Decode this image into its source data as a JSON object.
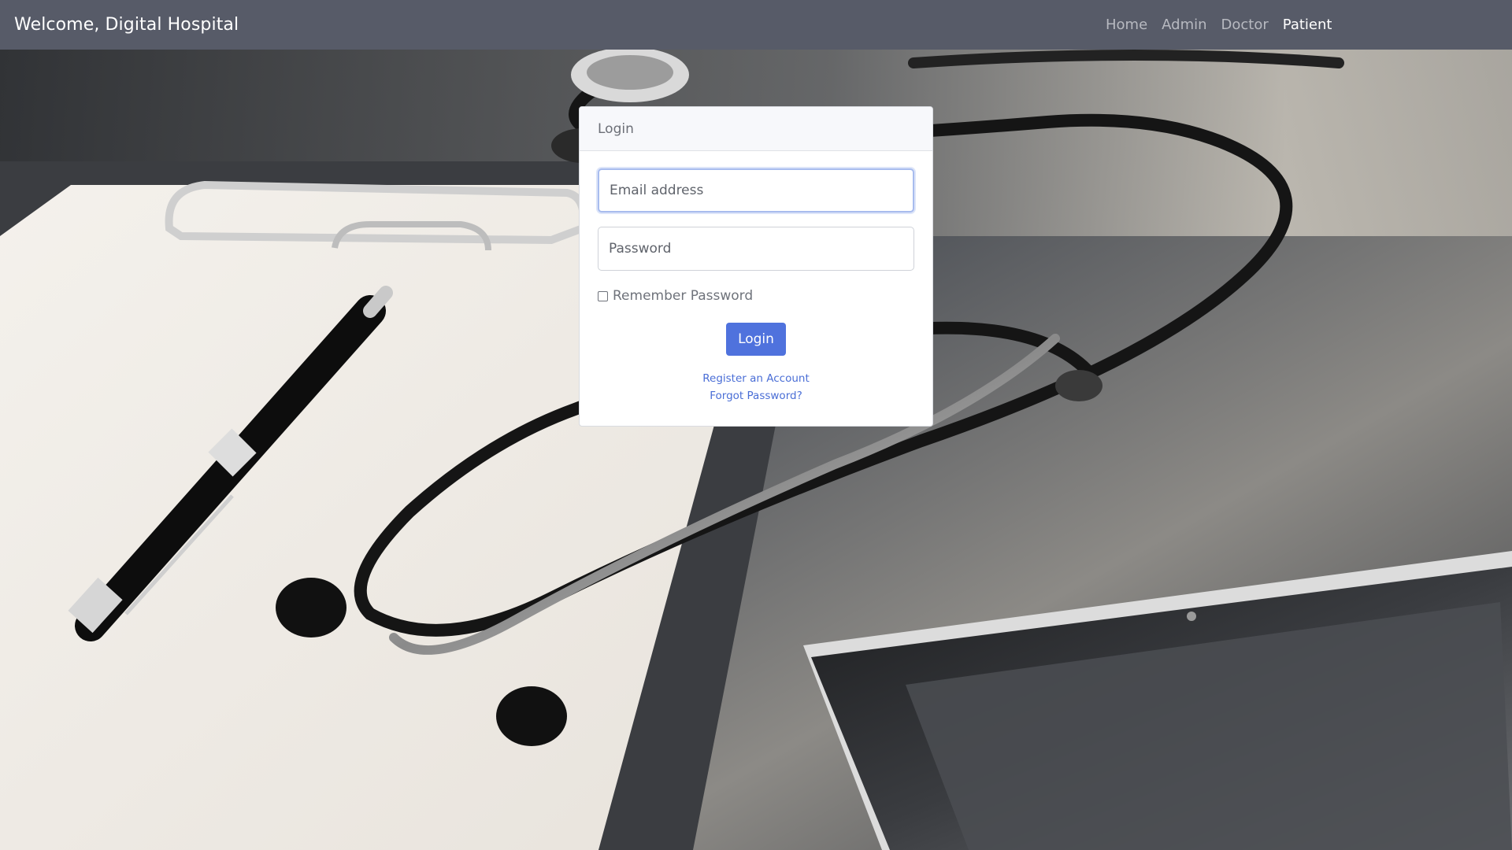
{
  "navbar": {
    "brand": "Welcome, Digital Hospital",
    "links": [
      {
        "label": "Home",
        "active": false
      },
      {
        "label": "Admin",
        "active": false
      },
      {
        "label": "Doctor",
        "active": false
      },
      {
        "label": "Patient",
        "active": true
      }
    ]
  },
  "login": {
    "title": "Login",
    "email_placeholder": "Email address",
    "email_value": "",
    "password_placeholder": "Password",
    "password_value": "",
    "remember_label": "Remember Password",
    "remember_checked": false,
    "submit_label": "Login",
    "register_link": "Register an Account",
    "forgot_link": "Forgot Password?"
  },
  "colors": {
    "navbar_bg": "#575b68",
    "accent": "#4f72dd",
    "link": "#4a6ed6"
  }
}
